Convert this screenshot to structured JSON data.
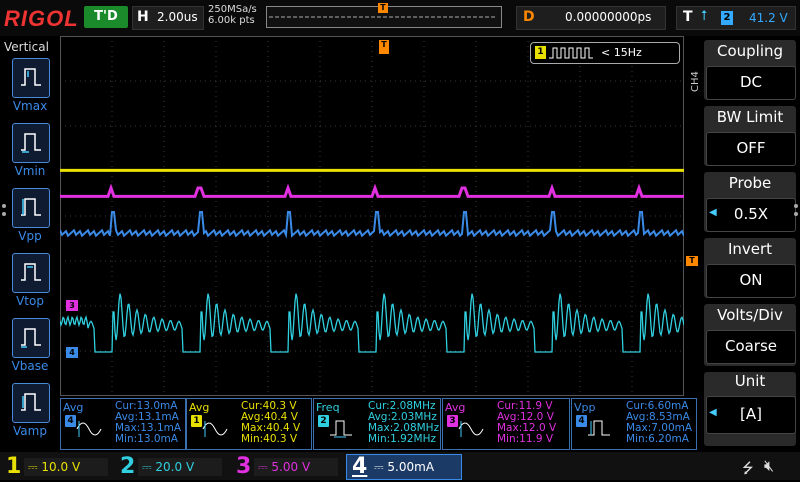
{
  "brand": "RIGOL",
  "status": "T'D",
  "horizontal": {
    "label": "H",
    "timebase": "2.00us"
  },
  "sample": {
    "rate": "250MSa/s",
    "points": "6.00k pts"
  },
  "delay": {
    "label": "D",
    "value": "0.00000000ps"
  },
  "trigger": {
    "label": "T",
    "edge_icon": "rising-edge-icon",
    "source": "2",
    "level": "41.2 V",
    "marker": "T"
  },
  "left_menu": {
    "title": "Vertical",
    "items": [
      {
        "label": "Vmax",
        "icon": "vmax-icon"
      },
      {
        "label": "Vmin",
        "icon": "vmin-icon"
      },
      {
        "label": "Vpp",
        "icon": "vpp-icon"
      },
      {
        "label": "Vtop",
        "icon": "vtop-icon"
      },
      {
        "label": "Vbase",
        "icon": "vbase-icon"
      },
      {
        "label": "Vamp",
        "icon": "vamp-icon"
      }
    ]
  },
  "counter": {
    "source": "1",
    "value": "< 15Hz"
  },
  "right_menu": {
    "side_label": "CH4",
    "items": [
      {
        "title": "Coupling",
        "value": "DC",
        "has_arrow": false
      },
      {
        "title": "BW Limit",
        "value": "OFF",
        "has_arrow": false
      },
      {
        "title": "Probe",
        "value": "0.5X",
        "has_arrow": true
      },
      {
        "title": "Invert",
        "value": "ON",
        "has_arrow": false
      },
      {
        "title": "Volts/Div",
        "value": "Coarse",
        "has_arrow": false
      },
      {
        "title": "Unit",
        "value": "[A]",
        "has_arrow": true
      }
    ]
  },
  "measurements": [
    {
      "name": "Avg",
      "channel": "4",
      "color": "#3a8ae8",
      "lines": [
        "Cur:13.0mA",
        "Avg:13.1mA",
        "Max:13.1mA",
        "Min:13.0mA"
      ]
    },
    {
      "name": "Avg",
      "channel": "1",
      "color": "#e8e000",
      "lines": [
        "Cur:40.3 V",
        "Avg:40.4 V",
        "Max:40.4 V",
        "Min:40.3 V"
      ]
    },
    {
      "name": "Freq",
      "channel": "2",
      "color": "#30d0e0",
      "lines": [
        "Cur:2.08MHz",
        "Avg:2.03MHz",
        "Max:2.08MHz",
        "Min:1.92MHz"
      ]
    },
    {
      "name": "Avg",
      "channel": "3",
      "color": "#e030e0",
      "lines": [
        "Cur:11.9 V",
        "Avg:12.0 V",
        "Max:12.0 V",
        "Min:11.9 V"
      ]
    },
    {
      "name": "Vpp",
      "channel": "4",
      "color": "#3a8ae8",
      "lines": [
        "Cur:6.60mA",
        "Avg:8.53mA",
        "Max:7.00mA",
        "Min:6.20mA"
      ]
    }
  ],
  "channels": [
    {
      "num": "1",
      "scale": "10.0 V",
      "color": "#e8e000"
    },
    {
      "num": "2",
      "scale": "20.0 V",
      "color": "#30d0e0"
    },
    {
      "num": "3",
      "scale": "5.00 V",
      "color": "#e030e0"
    },
    {
      "num": "4",
      "scale": "5.00mA",
      "color": "#3a8ae8"
    }
  ],
  "channel_markers": {
    "ch3": "3",
    "ch4": "4"
  },
  "colors": {
    "ch1": "#e8e000",
    "ch2": "#30d0e0",
    "ch3": "#e030e0",
    "ch4": "#3a8ae8",
    "trigger": "#ff8800",
    "grid": "#3a3a3a"
  }
}
